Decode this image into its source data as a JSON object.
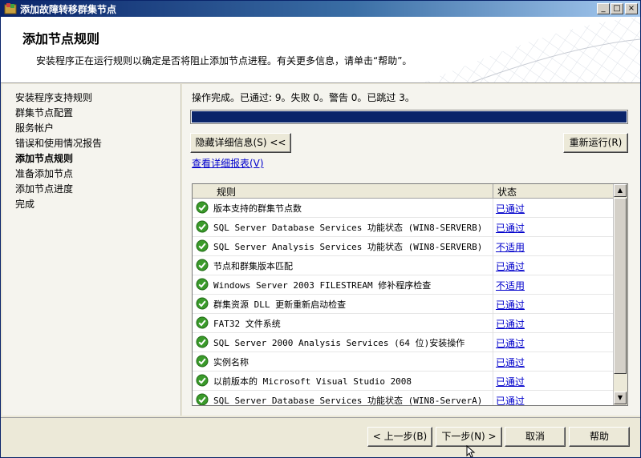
{
  "window": {
    "title": "添加故障转移群集节点",
    "controls": {
      "minimize": "_",
      "maximize": "□",
      "close": "×"
    }
  },
  "header": {
    "heading": "添加节点规则",
    "description": "安装程序正在运行规则以确定是否将阻止添加节点进程。有关更多信息，请单击“帮助”。"
  },
  "nav": {
    "items": [
      {
        "label": "安装程序支持规则",
        "active": false
      },
      {
        "label": "群集节点配置",
        "active": false
      },
      {
        "label": "服务帐户",
        "active": false
      },
      {
        "label": "错误和使用情况报告",
        "active": false
      },
      {
        "label": "添加节点规则",
        "active": true
      },
      {
        "label": "准备添加节点",
        "active": false
      },
      {
        "label": "添加节点进度",
        "active": false
      },
      {
        "label": "完成",
        "active": false
      }
    ]
  },
  "main": {
    "status_line": "操作完成。已通过: 9。失败 0。警告 0。已跳过 3。",
    "progress": 1.0,
    "hide_details_button": "隐藏详细信息(S) <<",
    "rerun_button": "重新运行(R)",
    "view_report_link": "查看详细报表(V)",
    "grid": {
      "columns": {
        "rule": "规则",
        "status": "状态"
      },
      "rows": [
        {
          "rule": "版本支持的群集节点数",
          "status": "已通过"
        },
        {
          "rule": "SQL Server Database Services 功能状态 (WIN8-SERVERB)",
          "status": "已通过"
        },
        {
          "rule": "SQL Server Analysis Services 功能状态 (WIN8-SERVERB)",
          "status": "不适用"
        },
        {
          "rule": "节点和群集版本匹配",
          "status": "已通过"
        },
        {
          "rule": "Windows Server 2003 FILESTREAM 修补程序检查",
          "status": "不适用"
        },
        {
          "rule": "群集资源 DLL 更新重新启动检查",
          "status": "已通过"
        },
        {
          "rule": "FAT32 文件系统",
          "status": "已通过"
        },
        {
          "rule": "SQL Server 2000 Analysis Services (64 位)安装操作",
          "status": "已通过"
        },
        {
          "rule": "实例名称",
          "status": "已通过"
        },
        {
          "rule": "以前版本的 Microsoft Visual Studio 2008",
          "status": "已通过"
        },
        {
          "rule": "SQL Server Database Services 功能状态 (WIN8-ServerA)",
          "status": "已通过"
        }
      ]
    }
  },
  "footer": {
    "back_button": "< 上一步(B)",
    "next_button": "下一步(N) >",
    "cancel_button": "取消",
    "help_button": "帮助"
  },
  "colors": {
    "title_bar": "#0a246a",
    "progress_fill": "#0a246a",
    "link": "#0000cc",
    "check_green": "#3a9a2a"
  },
  "icons": {
    "app": "app-setup-icon",
    "row_status": "green-check-icon"
  }
}
